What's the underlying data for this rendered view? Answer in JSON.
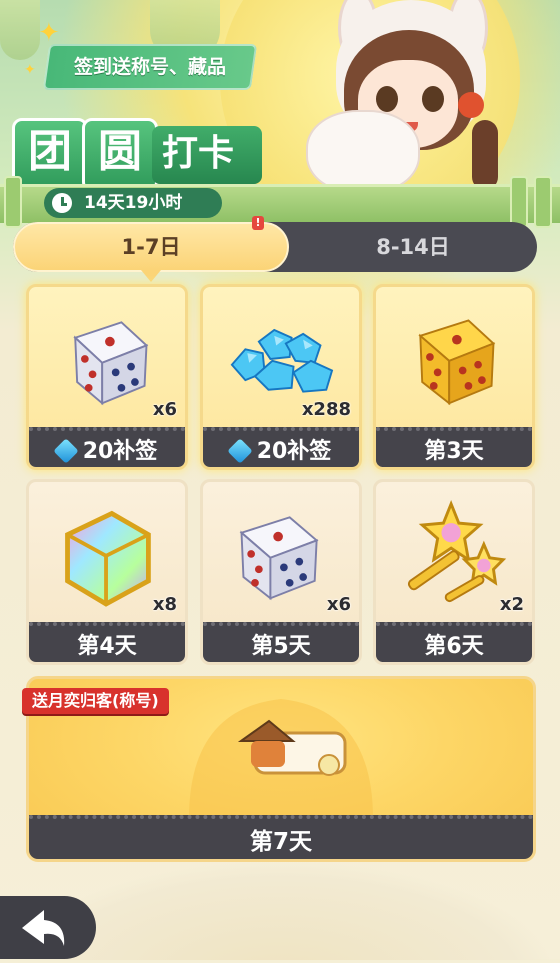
{
  "banner": {
    "promo_text": "签到送称号、藏品",
    "title_chars": [
      "团",
      "圆"
    ],
    "title_tail": "打卡",
    "timer": "14天19小时"
  },
  "tabs": [
    {
      "label": "1-7日",
      "active": true
    },
    {
      "label": "8-14日",
      "active": false
    }
  ],
  "tab_badge": "!",
  "rewards": [
    {
      "item": "white-dice",
      "qty": "x6",
      "footer": "20补签",
      "cost_icon": "gem",
      "state": "claimable"
    },
    {
      "item": "blue-gems",
      "qty": "x288",
      "footer": "20补签",
      "cost_icon": "gem",
      "state": "claimable"
    },
    {
      "item": "gold-dice",
      "qty": "",
      "footer": "第3天",
      "state": "claimable"
    },
    {
      "item": "rainbow-cube",
      "qty": "x8",
      "footer": "第4天",
      "state": "locked"
    },
    {
      "item": "white-dice",
      "qty": "x6",
      "footer": "第5天",
      "state": "locked"
    },
    {
      "item": "star-keys",
      "qty": "x2",
      "footer": "第6天",
      "state": "locked"
    }
  ],
  "day7": {
    "ribbon": "送月奕归客(称号)",
    "item": "title-badge",
    "footer": "第7天"
  },
  "colors": {
    "accent_green": "#3aa564",
    "tab_active": "#fbd477",
    "card_footer": "#45444b",
    "ribbon_red": "#d8322c"
  }
}
